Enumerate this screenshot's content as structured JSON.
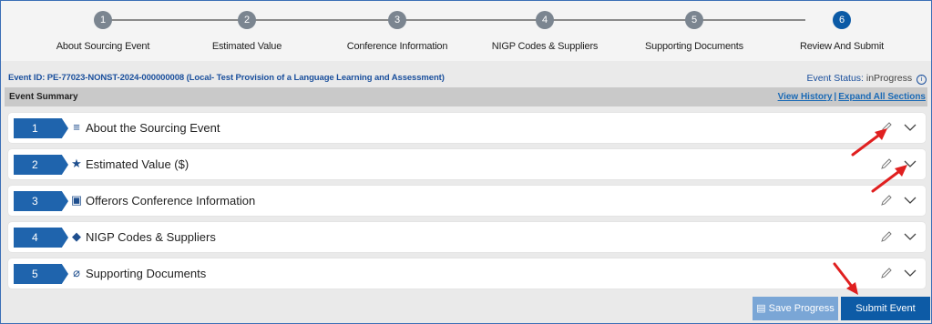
{
  "stepper": {
    "steps": [
      {
        "number": "1",
        "label": "About Sourcing Event"
      },
      {
        "number": "2",
        "label": "Estimated Value"
      },
      {
        "number": "3",
        "label": "Conference Information"
      },
      {
        "number": "4",
        "label": "NIGP Codes & Suppliers"
      },
      {
        "number": "5",
        "label": "Supporting Documents"
      },
      {
        "number": "6",
        "label": "Review And Submit"
      }
    ],
    "active_step": 6
  },
  "event": {
    "id_text": "Event ID: PE-77023-NONST-2024-000000008 (Local- Test Provision of a Language Learning and Assessment)",
    "status_label": "Event Status:",
    "status_value": "inProgress",
    "info_glyph": "i"
  },
  "summary": {
    "title": "Event Summary",
    "view_history": "View History",
    "separator": "|",
    "expand_all": "Expand All Sections"
  },
  "sections": [
    {
      "number": "1",
      "icon": "list-icon",
      "glyph": "≡",
      "title": "About the Sourcing Event"
    },
    {
      "number": "2",
      "icon": "star-icon",
      "glyph": "★",
      "title": "Estimated Value ($)"
    },
    {
      "number": "3",
      "icon": "calendar-icon",
      "glyph": "▣",
      "title": "Offerors Conference Information"
    },
    {
      "number": "4",
      "icon": "tag-icon",
      "glyph": "◆",
      "title": "NIGP Codes & Suppliers"
    },
    {
      "number": "5",
      "icon": "paperclip-icon",
      "glyph": "⌀",
      "title": "Supporting Documents"
    }
  ],
  "buttons": {
    "save_icon": "▤",
    "save_label": "Save Progress",
    "submit_label": "Submit Event"
  },
  "colors": {
    "primary": "#0d5ba6",
    "badge": "#1f64ad",
    "link": "#1a6ab6",
    "annotation_arrow": "#e02020"
  }
}
